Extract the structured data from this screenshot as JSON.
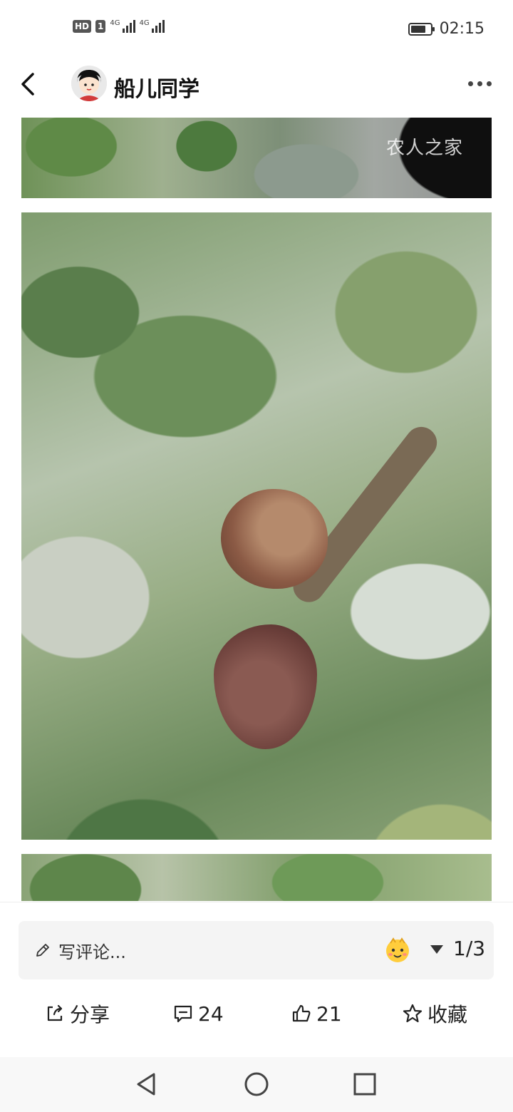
{
  "status_bar": {
    "hd_badge": "HD",
    "sim_label": "1",
    "network1": "4G",
    "network2": "4G",
    "battery_level": 0.75,
    "time": "02:15"
  },
  "header": {
    "username": "船儿同学"
  },
  "photos": {
    "watermark": "农人之家"
  },
  "bottom_bar": {
    "comment_placeholder": "写评论...",
    "page_indicator": "1/3",
    "share_label": "分享",
    "comment_count": "24",
    "like_count": "21",
    "favorite_label": "收藏"
  },
  "icons": {
    "back": "back-arrow-icon",
    "more": "more-options-icon",
    "edit": "pen-icon",
    "emoji": "emoji-icon",
    "dropdown": "triangle-down-icon",
    "share": "share-icon",
    "comment": "comment-icon",
    "like": "thumbs-up-icon",
    "favorite": "star-icon",
    "nav_back": "nav-back-icon",
    "nav_home": "nav-home-icon",
    "nav_recent": "nav-recent-icon"
  }
}
